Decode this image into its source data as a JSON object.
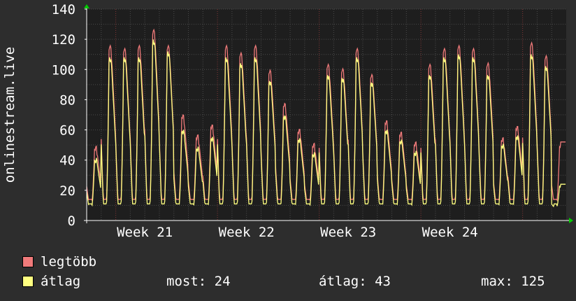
{
  "chart_data": {
    "type": "line",
    "ylabel": "onlinestream.live",
    "ylim": [
      0,
      140
    ],
    "yticks": [
      0,
      20,
      40,
      60,
      80,
      100,
      120,
      140
    ],
    "week_labels": [
      "Week 21",
      "Week 22",
      "Week 23",
      "Week 24"
    ],
    "grid": true,
    "colors": {
      "background": "#2d2d2d",
      "plot_area": "#1e1e1e",
      "grid_minor": "#4a4a4a",
      "grid_major": "#7a3030",
      "axis": "#ffffff",
      "max_line": "#f07a7a",
      "avg_line": "#ffff80"
    },
    "series": [
      {
        "name": "legtöbb",
        "color": "#f07a7a",
        "daily_peaks": [
          50,
          120,
          118,
          120,
          131,
          120,
          72,
          58,
          65,
          120,
          115,
          120,
          103,
          80,
          62,
          52,
          107,
          104,
          118,
          100,
          68,
          60,
          53,
          107,
          118,
          120,
          118,
          108,
          56,
          64,
          122,
          113,
          52
        ]
      },
      {
        "name": "átlag",
        "color": "#ffff80",
        "daily_peaks": [
          42,
          112,
          112,
          112,
          124,
          116,
          62,
          50,
          57,
          112,
          108,
          112,
          96,
          72,
          56,
          46,
          100,
          98,
          112,
          95,
          62,
          55,
          47,
          100,
          112,
          114,
          112,
          100,
          52,
          58,
          114,
          106,
          24
        ]
      }
    ]
  },
  "legend": {
    "max_label": "legtöbb",
    "avg_label": "átlag",
    "max_color": "#f07a7a",
    "avg_color": "#ffff80",
    "current_text": "most: 24",
    "average_text": "átlag: 43",
    "maximum_text": "max: 125"
  }
}
